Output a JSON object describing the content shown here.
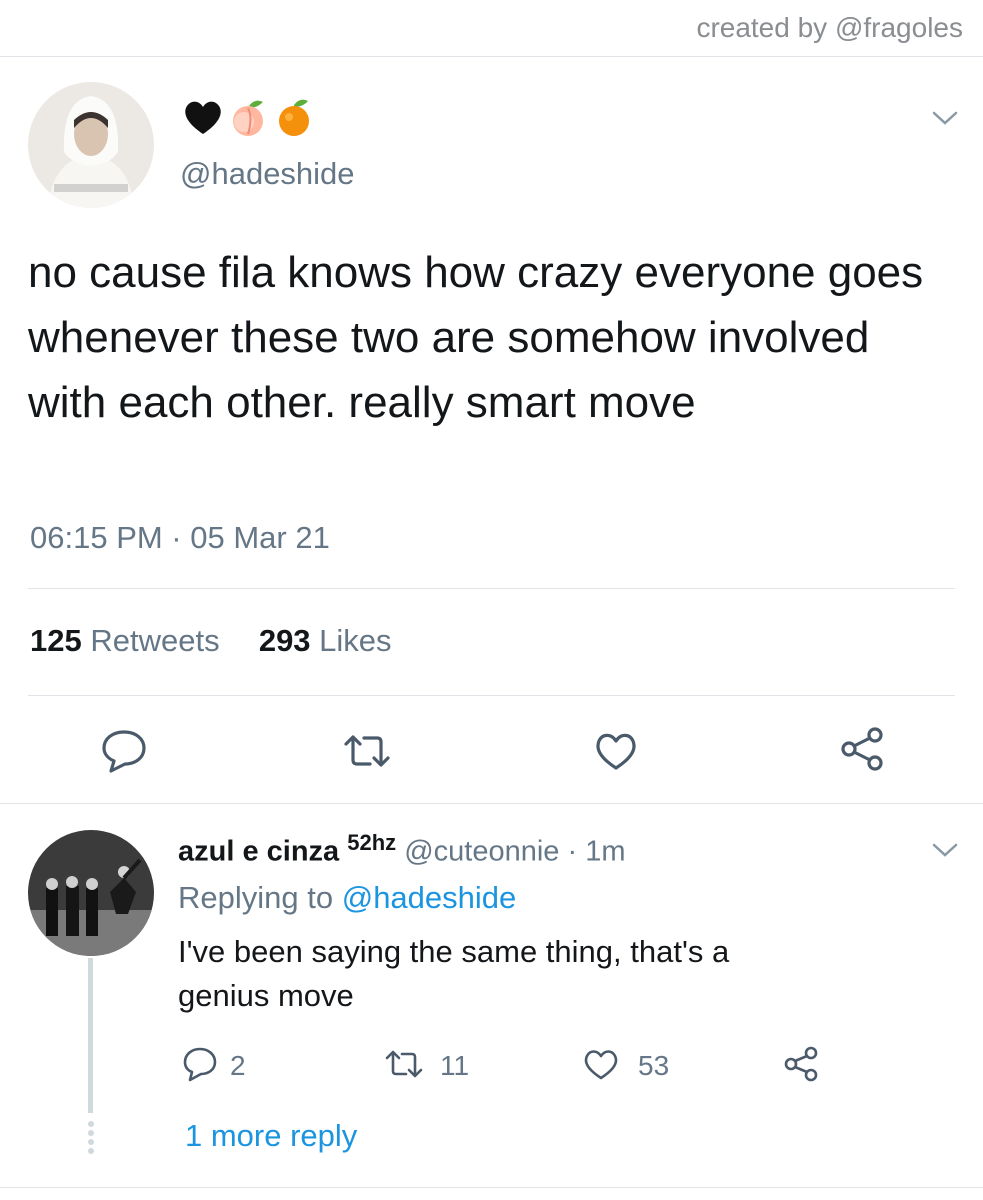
{
  "watermark": "created by @fragoles",
  "tweet": {
    "emojis": [
      "black-heart",
      "peach",
      "tangerine"
    ],
    "handle": "@hadeshide",
    "text": "no cause fila knows how crazy everyone goes whenever these two are somehow involved with each other. really smart move",
    "timestamp": "06:15 PM · 05 Mar 21",
    "retweets": "125",
    "retweets_label": " Retweets",
    "likes": "293",
    "likes_label": " Likes"
  },
  "reply": {
    "name": "azul e cinza",
    "badge": "52hz",
    "handle": "@cuteonnie",
    "time": " · 1m",
    "replying_prefix": "Replying to ",
    "replying_to": "@hadeshide",
    "text": "I've been saying the same thing, that's a genius move",
    "reply_count": "2",
    "retweet_count": "11",
    "like_count": "53"
  },
  "more_replies": "1 more reply",
  "colors": {
    "link": "#1b95e0",
    "muted": "#657786",
    "divider": "#dfe3e8",
    "icon": "#4a5a6a"
  }
}
